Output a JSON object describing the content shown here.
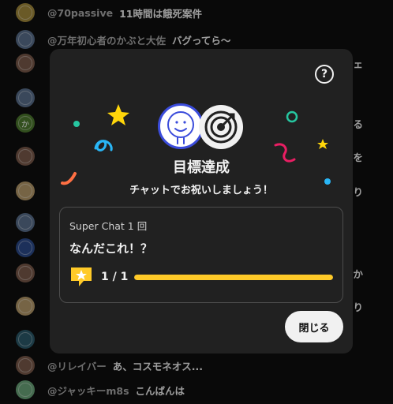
{
  "chat": {
    "rows": [
      {
        "author": "@70passive",
        "message": "11時間は餓死案件",
        "avatar_color": "#a38a3c"
      },
      {
        "author": "@万年初心者のかぶと大佐",
        "message": "バグってら〜",
        "avatar_color": "#5a6f8c"
      },
      {
        "author": "",
        "message": "",
        "tail": "チェ",
        "avatar_color": "#7a5a4a"
      },
      {
        "author": "",
        "message": "",
        "tail": "",
        "avatar_color": "#5a6f8c"
      },
      {
        "author": "",
        "message": "",
        "tail": "ある",
        "avatar_color": "#4e7a2e",
        "avatar_text": "か"
      },
      {
        "author": "",
        "message": "",
        "tail": "を",
        "avatar_color": "#7a5a4a"
      },
      {
        "author": "",
        "message": "",
        "tail": "周り",
        "avatar_color": "#b59a6a"
      },
      {
        "author": "",
        "message": "",
        "tail": "",
        "avatar_color": "#5a6f8c"
      },
      {
        "author": "",
        "message": "",
        "tail": "",
        "avatar_color": "#2c4a8a"
      },
      {
        "author": "",
        "message": "",
        "tail": "か",
        "avatar_color": "#7a5a4a"
      },
      {
        "author": "",
        "message": "",
        "tail": "あり",
        "avatar_color": "#b59a6a"
      },
      {
        "author": "",
        "message": "",
        "tail": "",
        "avatar_color": "#2c5a6a"
      },
      {
        "author": "@リレイバー",
        "message": "あ、コスモネオス...",
        "avatar_color": "#7a5a4a"
      },
      {
        "author": "@ジャッキーm8s",
        "message": "こんばんは",
        "avatar_color": "#6aa57a"
      }
    ]
  },
  "dialog": {
    "help_icon": "?",
    "title": "目標達成",
    "subtitle": "チャットでお祝いしましょう！",
    "goal": {
      "label": "Super Chat 1 回",
      "text": "なんだこれ！？",
      "count": "1 / 1",
      "progress": 1.0
    },
    "close_label": "閉じる"
  },
  "colors": {
    "progress": "#ffca28",
    "smile_badge_border": "#3b4cdb",
    "confetti_yellow": "#ffd60a",
    "confetti_pink": "#e91e63",
    "confetti_cyan": "#29b6f6",
    "confetti_green": "#26c6a0",
    "confetti_orange": "#ff7043"
  }
}
